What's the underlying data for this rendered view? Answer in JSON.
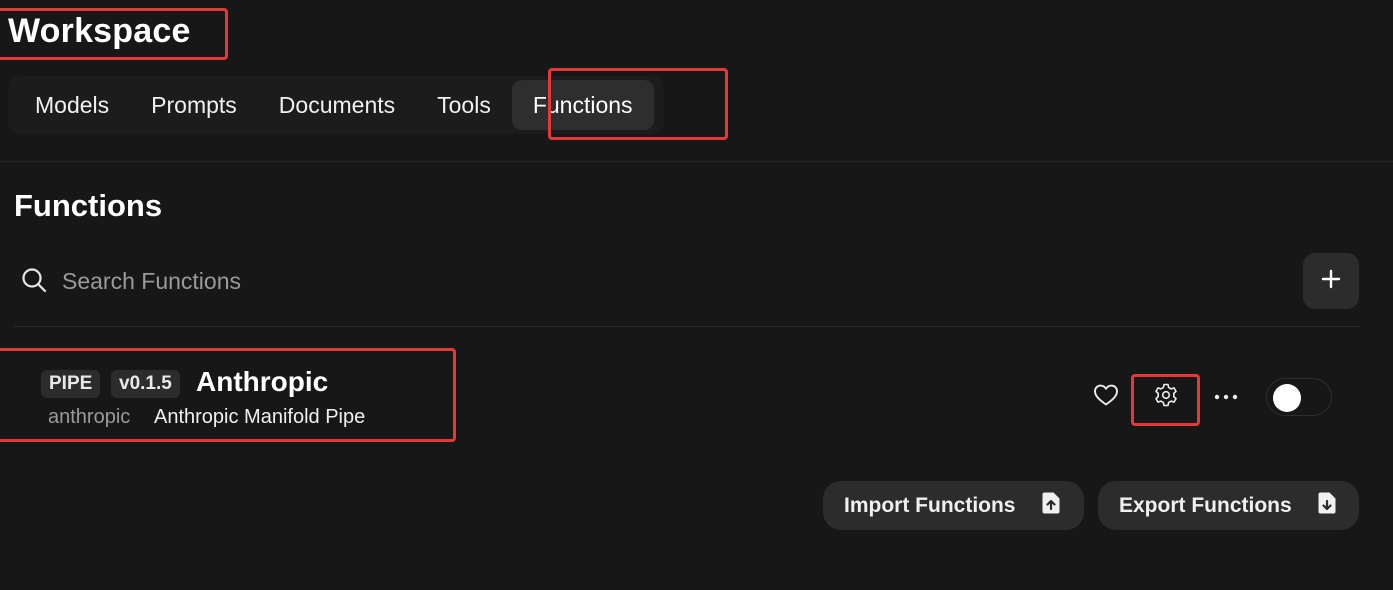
{
  "header": {
    "title": "Workspace"
  },
  "tabs": [
    {
      "label": "Models",
      "active": false
    },
    {
      "label": "Prompts",
      "active": false
    },
    {
      "label": "Documents",
      "active": false
    },
    {
      "label": "Tools",
      "active": false
    },
    {
      "label": "Functions",
      "active": true
    }
  ],
  "section": {
    "title": "Functions"
  },
  "search": {
    "placeholder": "Search Functions",
    "value": ""
  },
  "functions": [
    {
      "type_badge": "PIPE",
      "version_badge": "v0.1.5",
      "name": "Anthropic",
      "id": "anthropic",
      "description": "Anthropic Manifold Pipe",
      "enabled": false
    }
  ],
  "actions": {
    "import_label": "Import Functions",
    "export_label": "Export Functions"
  },
  "icons": {
    "search": "search-icon",
    "add": "plus-icon",
    "favorite": "heart-icon",
    "settings": "gear-icon",
    "more": "ellipsis-icon",
    "import": "file-upload-icon",
    "export": "file-download-icon"
  },
  "colors": {
    "background": "#171717",
    "surface": "#2c2c2c",
    "highlight": "#e5383b",
    "text": "#ececec",
    "muted_text": "#9a9a9a"
  }
}
